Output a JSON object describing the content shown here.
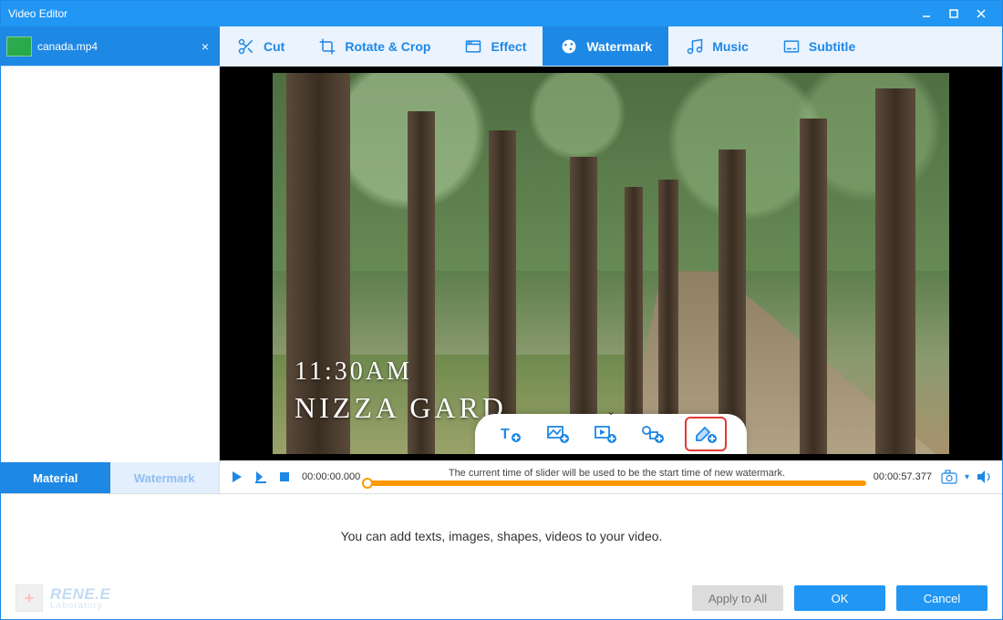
{
  "window": {
    "title": "Video Editor"
  },
  "file_tab": {
    "name": "canada.mp4"
  },
  "tool_tabs": [
    {
      "id": "cut",
      "label": "Cut"
    },
    {
      "id": "rotate",
      "label": "Rotate & Crop"
    },
    {
      "id": "effect",
      "label": "Effect"
    },
    {
      "id": "watermark",
      "label": "Watermark",
      "active": true
    },
    {
      "id": "music",
      "label": "Music"
    },
    {
      "id": "subtitle",
      "label": "Subtitle"
    }
  ],
  "sidebar_tabs": {
    "material": "Material",
    "watermark": "Watermark"
  },
  "preview_overlay": {
    "time_text": "11:30AM",
    "place_text": "NIZZA GARD"
  },
  "watermark_toolbar": {
    "items": [
      {
        "id": "add-text",
        "name": "add-text-watermark-icon"
      },
      {
        "id": "add-image",
        "name": "add-image-watermark-icon"
      },
      {
        "id": "add-video",
        "name": "add-video-watermark-icon"
      },
      {
        "id": "add-shape",
        "name": "add-shape-watermark-icon"
      },
      {
        "id": "add-remove",
        "name": "remove-watermark-icon",
        "highlighted": true
      }
    ]
  },
  "timeline": {
    "current": "00:00:00.000",
    "duration": "00:00:57.377",
    "hint": "The current time of slider will be used to be the start time of new watermark."
  },
  "bottom": {
    "message": "You can add texts, images, shapes, videos to your video.",
    "apply_all": "Apply to All",
    "ok": "OK",
    "cancel": "Cancel"
  },
  "brand": {
    "name": "RENE.E",
    "sub": "Laboratory"
  }
}
